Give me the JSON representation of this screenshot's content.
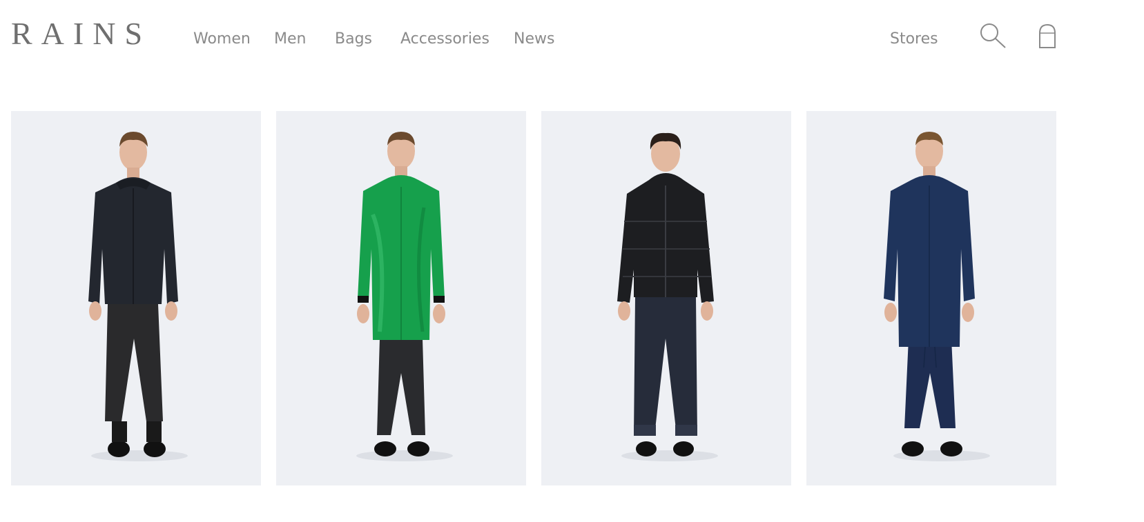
{
  "brand": {
    "logo_text": "RAINS"
  },
  "nav": {
    "items": [
      {
        "label": "Women"
      },
      {
        "label": "Men"
      },
      {
        "label": "Bags"
      },
      {
        "label": "Accessories"
      },
      {
        "label": "News"
      }
    ],
    "stores_label": "Stores"
  },
  "icons": {
    "search": "search-icon",
    "bag": "shopping-bag-icon"
  },
  "products": [
    {
      "jacket_color": "#23272f",
      "pants_color": "#2a2a2c",
      "hair_color": "#6b4a2e"
    },
    {
      "jacket_color": "#16a04c",
      "pants_color": "#2a2b2e",
      "hair_color": "#6b4a2e"
    },
    {
      "jacket_color": "#1d1e21",
      "pants_color": "#262c3a",
      "hair_color": "#2a1f1a"
    },
    {
      "jacket_color": "#1f345c",
      "pants_color": "#1e2d52",
      "hair_color": "#7a5632"
    }
  ],
  "colors": {
    "card_background": "#eef0f4",
    "nav_text": "#8a8a8a",
    "logo": "#6f6f6f"
  }
}
